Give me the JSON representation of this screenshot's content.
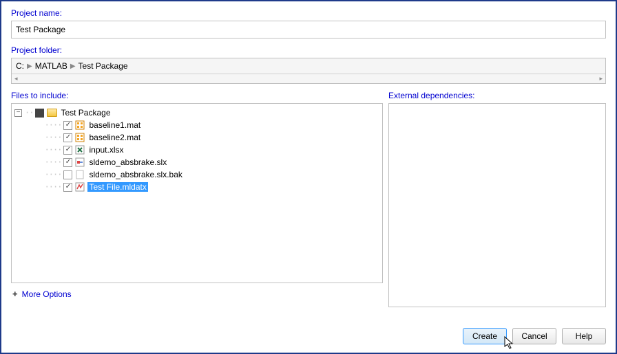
{
  "labels": {
    "project_name": "Project name:",
    "project_folder": "Project folder:",
    "files_to_include": "Files to include:",
    "external_dependencies": "External dependencies:",
    "more_options": "More Options"
  },
  "project_name_value": "Test Package",
  "breadcrumb": {
    "seg0": "C:",
    "seg1": "MATLAB",
    "seg2": "Test Package"
  },
  "file_tree": {
    "root": {
      "label": "Test Package",
      "checked": "solid"
    },
    "items": [
      {
        "label": "baseline1.mat",
        "checked": true,
        "icon": "mat"
      },
      {
        "label": "baseline2.mat",
        "checked": true,
        "icon": "mat"
      },
      {
        "label": "input.xlsx",
        "checked": true,
        "icon": "xlsx"
      },
      {
        "label": "sldemo_absbrake.slx",
        "checked": true,
        "icon": "slx"
      },
      {
        "label": "sldemo_absbrake.slx.bak",
        "checked": false,
        "icon": "blank"
      },
      {
        "label": "Test File.mldatx",
        "checked": true,
        "icon": "mldatx",
        "selected": true
      }
    ]
  },
  "buttons": {
    "create": "Create",
    "cancel": "Cancel",
    "help": "Help"
  }
}
